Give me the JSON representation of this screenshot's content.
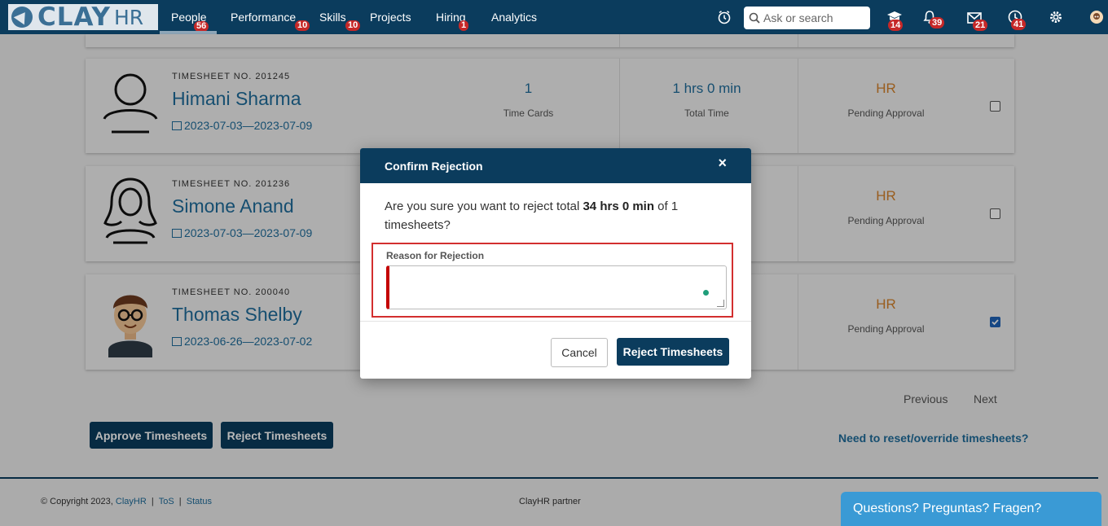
{
  "brand": {
    "name_part1": "CLAY",
    "name_part2": "HR"
  },
  "nav": [
    {
      "label": "People",
      "badge": "56"
    },
    {
      "label": "Performance",
      "badge": "10"
    },
    {
      "label": "Skills",
      "badge": "10"
    },
    {
      "label": "Projects",
      "badge": ""
    },
    {
      "label": "Hiring",
      "badge": "1"
    },
    {
      "label": "Analytics",
      "badge": ""
    }
  ],
  "search": {
    "placeholder": "Ask or search"
  },
  "toolbar": {
    "icons": [
      {
        "name": "clock-icon",
        "badge": ""
      },
      {
        "name": "learning-icon",
        "badge": "14"
      },
      {
        "name": "bell-icon",
        "badge": "39"
      },
      {
        "name": "mail-icon",
        "badge": "21"
      },
      {
        "name": "help-icon",
        "badge": "41"
      },
      {
        "name": "gear-icon",
        "badge": ""
      },
      {
        "name": "user-avatar-icon",
        "badge": ""
      }
    ]
  },
  "timesheets": [
    {
      "ts_no": "TIMESHEET NO. 201245",
      "name": "Himani Sharma",
      "dates": "2023-07-03—2023-07-09",
      "time_cards": "1",
      "time_cards_label": "Time Cards",
      "total_time": "1 hrs 0 min",
      "total_time_label": "Total Time",
      "approver": "HR",
      "status": "Pending Approval",
      "checked": false
    },
    {
      "ts_no": "TIMESHEET NO. 201236",
      "name": "Simone Anand",
      "dates": "2023-07-03—2023-07-09",
      "approver": "HR",
      "status": "Pending Approval",
      "checked": false
    },
    {
      "ts_no": "TIMESHEET NO. 200040",
      "name": "Thomas Shelby",
      "dates": "2023-06-26—2023-07-02",
      "approver": "HR",
      "status": "Pending Approval",
      "checked": true
    }
  ],
  "pagination": {
    "previous": "Previous",
    "next": "Next"
  },
  "actions": {
    "approve": "Approve Timesheets",
    "reject": "Reject Timesheets",
    "reset_link": "Need to reset/override timesheets?"
  },
  "footer": {
    "copyright": "© Copyright 2023,",
    "brand_link": "ClayHR",
    "tos": "ToS",
    "status": "Status",
    "sep": "|",
    "partner": "ClayHR partner"
  },
  "chat": {
    "label": "Questions? Preguntas? Fragen?"
  },
  "modal": {
    "title": "Confirm Rejection",
    "close": "×",
    "message_pre": "Are you sure you want to reject total ",
    "message_bold": "34 hrs 0 min",
    "message_post": " of 1 timesheets?",
    "reason_label": "Reason for Rejection",
    "reason_value": "",
    "cancel": "Cancel",
    "confirm": "Reject Timesheets"
  },
  "colors": {
    "navy": "#0b3c5d",
    "link": "#1f6d9b",
    "hr_orange": "#d4812a",
    "badge_red": "#c62828",
    "error_red": "#d32f2f"
  }
}
